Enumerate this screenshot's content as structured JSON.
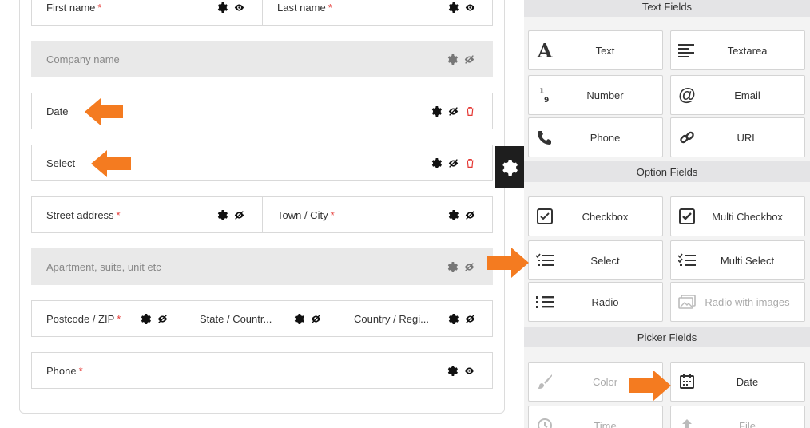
{
  "form": {
    "first_name": "First name",
    "last_name": "Last name",
    "company_name": "Company name",
    "date": "Date",
    "select": "Select",
    "street_address": "Street address",
    "town_city": "Town / City",
    "apartment": "Apartment, suite, unit etc",
    "postcode": "Postcode / ZIP",
    "state": "State / Countr...",
    "country": "Country / Regi...",
    "phone": "Phone",
    "required_mark": "*"
  },
  "palette": {
    "text_fields_heading": "Text Fields",
    "option_fields_heading": "Option Fields",
    "picker_fields_heading": "Picker Fields",
    "text": "Text",
    "textarea": "Textarea",
    "number": "Number",
    "email": "Email",
    "phone": "Phone",
    "url": "URL",
    "checkbox": "Checkbox",
    "multi_checkbox": "Multi Checkbox",
    "select": "Select",
    "multi_select": "Multi Select",
    "radio": "Radio",
    "radio_images": "Radio with images",
    "color": "Color",
    "date": "Date",
    "time": "Time",
    "file": "File"
  },
  "colors": {
    "accent_arrow": "#f47b20",
    "required": "#e53935",
    "delete": "#e53935",
    "gear_tab_bg": "#1e1e1e"
  }
}
